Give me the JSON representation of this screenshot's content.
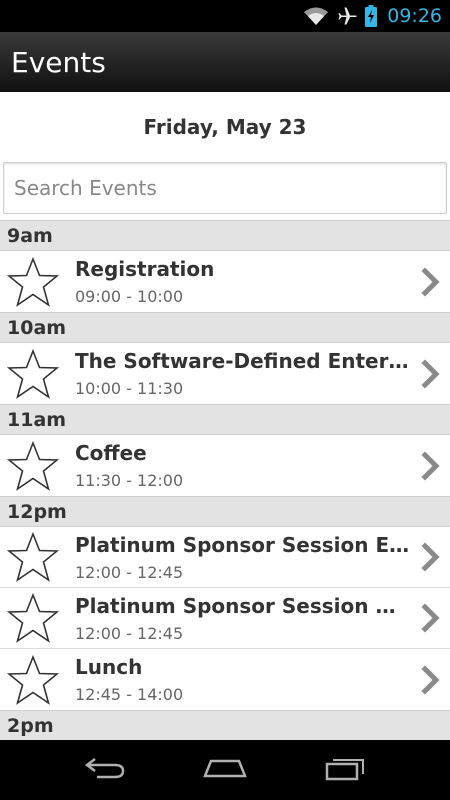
{
  "status_bar": {
    "time": "09:26",
    "icons": [
      "wifi-icon",
      "airplane-icon",
      "battery-charging-icon"
    ],
    "accent_color": "#33b5e5"
  },
  "action_bar": {
    "title": "Events"
  },
  "date_heading": "Friday, May 23",
  "search": {
    "placeholder": "Search Events",
    "value": ""
  },
  "sections": [
    {
      "header": "9am",
      "events": [
        {
          "title": "Registration",
          "time": "09:00 - 10:00"
        }
      ]
    },
    {
      "header": "10am",
      "events": [
        {
          "title": "The Software-Defined Enterpris…",
          "time": "10:00 - 11:30"
        }
      ]
    },
    {
      "header": "11am",
      "events": [
        {
          "title": "Coffee",
          "time": "11:30 - 12:00"
        }
      ]
    },
    {
      "header": "12pm",
      "events": [
        {
          "title": "Platinum Sponsor Session EMC",
          "time": "12:00 - 12:45"
        },
        {
          "title": "Platinum Sponsor Session Cisco",
          "time": "12:00 - 12:45"
        },
        {
          "title": "Lunch",
          "time": "12:45 - 14:00"
        }
      ]
    },
    {
      "header": "2pm",
      "events": []
    }
  ],
  "nav_bar": {
    "buttons": [
      "back-icon",
      "home-icon",
      "recent-apps-icon"
    ]
  }
}
